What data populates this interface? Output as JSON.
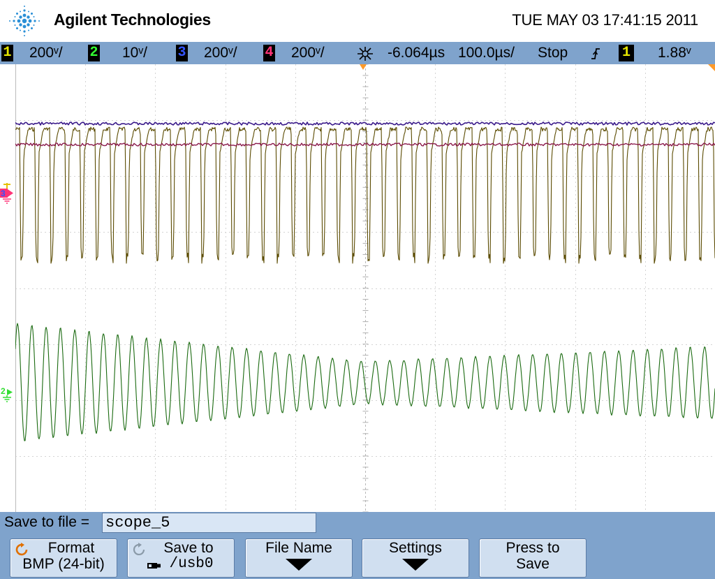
{
  "header": {
    "brand": "Agilent Technologies",
    "datetime": "TUE MAY 03 17:41:15 2011",
    "logo": "agilent-spark-icon"
  },
  "status_bar": {
    "channels": [
      {
        "number": "1",
        "scale": "200ᵛ/",
        "color": "#e6e600"
      },
      {
        "number": "2",
        "scale": "10ᵛ/",
        "color": "#33ff33"
      },
      {
        "number": "3",
        "scale": "200ᵛ/",
        "color": "#3355ff"
      },
      {
        "number": "4",
        "scale": "200ᵛ/",
        "color": "#ff3377"
      }
    ],
    "delay": "-6.064µs",
    "timebase": "100.0µs/",
    "run_state": "Stop",
    "trigger_source": "1",
    "trigger_level": "1.88ᵛ",
    "trigger_source_color": "#e6e600"
  },
  "traces": {
    "ch1_color": "#5a4a00",
    "ch2_color": "#1a6a10",
    "ch3_color": "#3a1a8a",
    "ch4_color": "#8a1a4a"
  },
  "save": {
    "label": "Save to file =",
    "filename": "scope_5"
  },
  "softkeys": [
    {
      "line1": "Format",
      "line2": "BMP (24-bit)",
      "icon": "rotate-icon"
    },
    {
      "line1": "Save to",
      "line2": "/usb0",
      "icon": "rotate-icon"
    },
    {
      "line1": "File Name",
      "line2": "",
      "icon": "arrow-down-icon"
    },
    {
      "line1": "Settings",
      "line2": "",
      "icon": "arrow-down-icon"
    },
    {
      "line1": "Press to",
      "line2": "Save",
      "icon": ""
    }
  ],
  "channel_markers": {
    "marker_34": "3",
    "marker_2": "2"
  }
}
